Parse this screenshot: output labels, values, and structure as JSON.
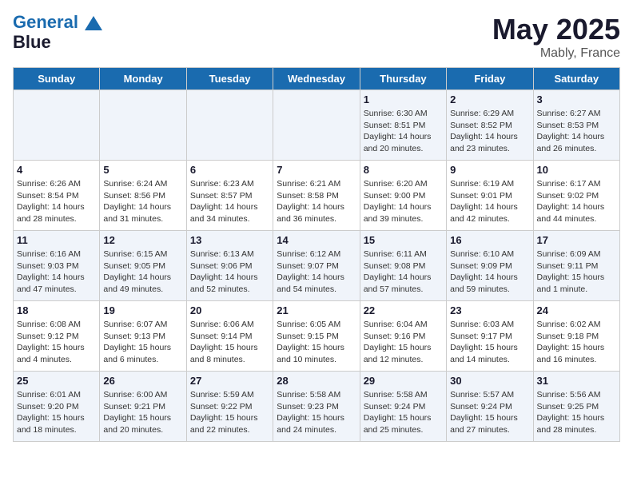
{
  "header": {
    "logo_line1": "General",
    "logo_line2": "Blue",
    "month": "May 2025",
    "location": "Mably, France"
  },
  "days_of_week": [
    "Sunday",
    "Monday",
    "Tuesday",
    "Wednesday",
    "Thursday",
    "Friday",
    "Saturday"
  ],
  "weeks": [
    [
      {
        "day": "",
        "info": ""
      },
      {
        "day": "",
        "info": ""
      },
      {
        "day": "",
        "info": ""
      },
      {
        "day": "",
        "info": ""
      },
      {
        "day": "1",
        "info": "Sunrise: 6:30 AM\nSunset: 8:51 PM\nDaylight: 14 hours\nand 20 minutes."
      },
      {
        "day": "2",
        "info": "Sunrise: 6:29 AM\nSunset: 8:52 PM\nDaylight: 14 hours\nand 23 minutes."
      },
      {
        "day": "3",
        "info": "Sunrise: 6:27 AM\nSunset: 8:53 PM\nDaylight: 14 hours\nand 26 minutes."
      }
    ],
    [
      {
        "day": "4",
        "info": "Sunrise: 6:26 AM\nSunset: 8:54 PM\nDaylight: 14 hours\nand 28 minutes."
      },
      {
        "day": "5",
        "info": "Sunrise: 6:24 AM\nSunset: 8:56 PM\nDaylight: 14 hours\nand 31 minutes."
      },
      {
        "day": "6",
        "info": "Sunrise: 6:23 AM\nSunset: 8:57 PM\nDaylight: 14 hours\nand 34 minutes."
      },
      {
        "day": "7",
        "info": "Sunrise: 6:21 AM\nSunset: 8:58 PM\nDaylight: 14 hours\nand 36 minutes."
      },
      {
        "day": "8",
        "info": "Sunrise: 6:20 AM\nSunset: 9:00 PM\nDaylight: 14 hours\nand 39 minutes."
      },
      {
        "day": "9",
        "info": "Sunrise: 6:19 AM\nSunset: 9:01 PM\nDaylight: 14 hours\nand 42 minutes."
      },
      {
        "day": "10",
        "info": "Sunrise: 6:17 AM\nSunset: 9:02 PM\nDaylight: 14 hours\nand 44 minutes."
      }
    ],
    [
      {
        "day": "11",
        "info": "Sunrise: 6:16 AM\nSunset: 9:03 PM\nDaylight: 14 hours\nand 47 minutes."
      },
      {
        "day": "12",
        "info": "Sunrise: 6:15 AM\nSunset: 9:05 PM\nDaylight: 14 hours\nand 49 minutes."
      },
      {
        "day": "13",
        "info": "Sunrise: 6:13 AM\nSunset: 9:06 PM\nDaylight: 14 hours\nand 52 minutes."
      },
      {
        "day": "14",
        "info": "Sunrise: 6:12 AM\nSunset: 9:07 PM\nDaylight: 14 hours\nand 54 minutes."
      },
      {
        "day": "15",
        "info": "Sunrise: 6:11 AM\nSunset: 9:08 PM\nDaylight: 14 hours\nand 57 minutes."
      },
      {
        "day": "16",
        "info": "Sunrise: 6:10 AM\nSunset: 9:09 PM\nDaylight: 14 hours\nand 59 minutes."
      },
      {
        "day": "17",
        "info": "Sunrise: 6:09 AM\nSunset: 9:11 PM\nDaylight: 15 hours\nand 1 minute."
      }
    ],
    [
      {
        "day": "18",
        "info": "Sunrise: 6:08 AM\nSunset: 9:12 PM\nDaylight: 15 hours\nand 4 minutes."
      },
      {
        "day": "19",
        "info": "Sunrise: 6:07 AM\nSunset: 9:13 PM\nDaylight: 15 hours\nand 6 minutes."
      },
      {
        "day": "20",
        "info": "Sunrise: 6:06 AM\nSunset: 9:14 PM\nDaylight: 15 hours\nand 8 minutes."
      },
      {
        "day": "21",
        "info": "Sunrise: 6:05 AM\nSunset: 9:15 PM\nDaylight: 15 hours\nand 10 minutes."
      },
      {
        "day": "22",
        "info": "Sunrise: 6:04 AM\nSunset: 9:16 PM\nDaylight: 15 hours\nand 12 minutes."
      },
      {
        "day": "23",
        "info": "Sunrise: 6:03 AM\nSunset: 9:17 PM\nDaylight: 15 hours\nand 14 minutes."
      },
      {
        "day": "24",
        "info": "Sunrise: 6:02 AM\nSunset: 9:18 PM\nDaylight: 15 hours\nand 16 minutes."
      }
    ],
    [
      {
        "day": "25",
        "info": "Sunrise: 6:01 AM\nSunset: 9:20 PM\nDaylight: 15 hours\nand 18 minutes."
      },
      {
        "day": "26",
        "info": "Sunrise: 6:00 AM\nSunset: 9:21 PM\nDaylight: 15 hours\nand 20 minutes."
      },
      {
        "day": "27",
        "info": "Sunrise: 5:59 AM\nSunset: 9:22 PM\nDaylight: 15 hours\nand 22 minutes."
      },
      {
        "day": "28",
        "info": "Sunrise: 5:58 AM\nSunset: 9:23 PM\nDaylight: 15 hours\nand 24 minutes."
      },
      {
        "day": "29",
        "info": "Sunrise: 5:58 AM\nSunset: 9:24 PM\nDaylight: 15 hours\nand 25 minutes."
      },
      {
        "day": "30",
        "info": "Sunrise: 5:57 AM\nSunset: 9:24 PM\nDaylight: 15 hours\nand 27 minutes."
      },
      {
        "day": "31",
        "info": "Sunrise: 5:56 AM\nSunset: 9:25 PM\nDaylight: 15 hours\nand 28 minutes."
      }
    ]
  ]
}
